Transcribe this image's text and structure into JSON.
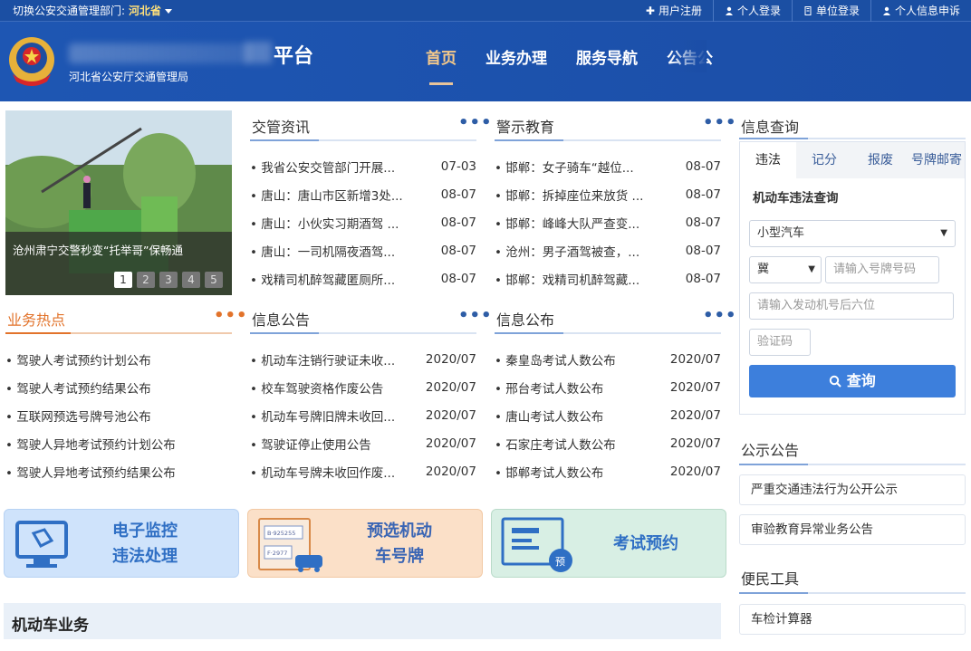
{
  "topbar": {
    "dept_label": "切换公安交通管理部门:",
    "dept_value": "河北省",
    "links": [
      {
        "label": "用户注册",
        "icon": "plus-icon"
      },
      {
        "label": "个人登录",
        "icon": "user-icon"
      },
      {
        "label": "单位登录",
        "icon": "building-icon"
      },
      {
        "label": "个人信息申诉",
        "icon": "user-icon"
      }
    ]
  },
  "header": {
    "title_fragment": "平台",
    "subtitle": "河北省公安厅交通管理局",
    "nav": [
      "首页",
      "业务办理",
      "服务导航",
      "公告公"
    ]
  },
  "slider": {
    "caption": "沧州肃宁交警秒变“托举哥”保畅通",
    "pages": [
      "1",
      "2",
      "3",
      "4",
      "5"
    ]
  },
  "sections": {
    "jgzx": {
      "title": "交管资讯",
      "more": "•••",
      "items": [
        {
          "t": "• 我省公安交管部门开展...",
          "d": "07-03"
        },
        {
          "t": "• 唐山：唐山市区新增3处...",
          "d": "08-07"
        },
        {
          "t": "• 唐山：小伙实习期酒驾 ...",
          "d": "08-07"
        },
        {
          "t": "• 唐山：一司机隔夜酒驾...",
          "d": "08-07"
        },
        {
          "t": "• 戏精司机醉驾藏匿厕所...",
          "d": "08-07"
        }
      ]
    },
    "jsjy": {
      "title": "警示教育",
      "more": "•••",
      "items": [
        {
          "t": "• 邯郸：女子骑车“越位...",
          "d": "08-07"
        },
        {
          "t": "• 邯郸：拆掉座位来放货 ...",
          "d": "08-07"
        },
        {
          "t": "• 邯郸：峰峰大队严查变...",
          "d": "08-07"
        },
        {
          "t": "• 沧州：男子酒驾被查，...",
          "d": "08-07"
        },
        {
          "t": "• 邯郸：戏精司机醉驾藏...",
          "d": "08-07"
        }
      ]
    },
    "ywrd": {
      "title": "业务热点",
      "more": "•••",
      "items": [
        "• 驾驶人考试预约计划公布",
        "• 驾驶人考试预约结果公布",
        "• 互联网预选号牌号池公布",
        "• 驾驶人异地考试预约计划公布",
        "• 驾驶人异地考试预约结果公布"
      ]
    },
    "xxgg": {
      "title": "信息公告",
      "more": "•••",
      "items": [
        {
          "t": "• 机动车注销行驶证未收...",
          "d": "2020/07"
        },
        {
          "t": "• 校车驾驶资格作废公告",
          "d": "2020/07"
        },
        {
          "t": "• 机动车号牌旧牌未收回...",
          "d": "2020/07"
        },
        {
          "t": "• 驾驶证停止使用公告",
          "d": "2020/07"
        },
        {
          "t": "• 机动车号牌未收回作废...",
          "d": "2020/07"
        }
      ]
    },
    "xxgb": {
      "title": "信息公布",
      "more": "•••",
      "items": [
        {
          "t": "• 秦皇岛考试人数公布",
          "d": "2020/07"
        },
        {
          "t": "• 邢台考试人数公布",
          "d": "2020/07"
        },
        {
          "t": "• 唐山考试人数公布",
          "d": "2020/07"
        },
        {
          "t": "• 石家庄考试人数公布",
          "d": "2020/07"
        },
        {
          "t": "• 邯郸考试人数公布",
          "d": "2020/07"
        }
      ]
    }
  },
  "tiles": {
    "t1": "电子监控\n违法处理",
    "t2": "预选机动\n车号牌",
    "t3": "考试预约",
    "plate1": "B·925255",
    "plate2": "F·2977",
    "badge": "预"
  },
  "motor": {
    "title": "机动车业务"
  },
  "query": {
    "title": "信息查询",
    "tabs": [
      "违法",
      "记分",
      "报废",
      "号牌邮寄"
    ],
    "subtitle": "机动车违法查询",
    "vehicle_type": "小型汽车",
    "province": "冀",
    "plate_ph": "请输入号牌号码",
    "engine_ph": "请输入发动机号后六位",
    "captcha_ph": "验证码",
    "button": "查询"
  },
  "gsgg": {
    "title": "公示公告",
    "items": [
      "严重交通违法行为公开公示",
      "审验教育异常业务公告"
    ]
  },
  "bmgj": {
    "title": "便民工具",
    "items": [
      "车检计算器"
    ]
  },
  "colors": {
    "header": "#1b4ea7",
    "accent_orange": "#e2732b",
    "button": "#3d7fdc"
  }
}
